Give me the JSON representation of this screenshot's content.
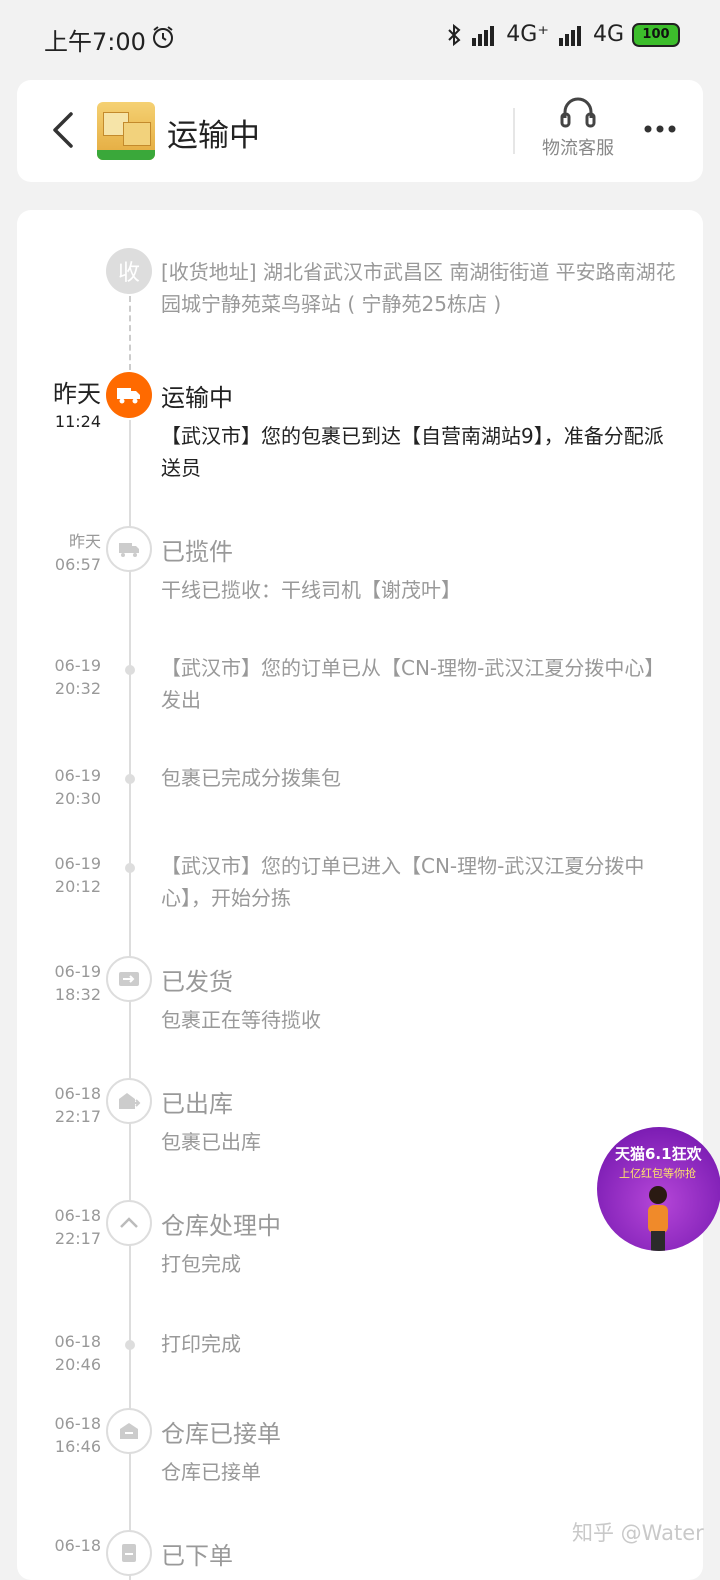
{
  "status_bar": {
    "time": "上午7:00",
    "network1": "4G⁺",
    "network2": "4G",
    "battery": "100"
  },
  "header": {
    "title": "运输中",
    "service_label": "物流客服"
  },
  "address": {
    "icon_char": "收",
    "text": "[收货地址] 湖北省武汉市武昌区 南湖街街道   平安路南湖花园城宁静苑菜鸟驿站 ( 宁静苑25栋店 )"
  },
  "events": [
    {
      "date": "昨天",
      "time": "11:24",
      "title": "运输中",
      "desc": "【武汉市】您的包裹已到达【自营南湖站9】，准备分配派送员",
      "icon": "truck-icon"
    },
    {
      "date": "昨天",
      "time": "06:57",
      "title": "已揽件",
      "desc": "干线已揽收：干线司机【谢茂叶】",
      "icon": "delivery-van-icon"
    },
    {
      "date": "06-19",
      "time": "20:32",
      "title": "",
      "desc": "【武汉市】您的订单已从【CN-理物-武汉江夏分拨中心】发出"
    },
    {
      "date": "06-19",
      "time": "20:30",
      "title": "",
      "desc": "包裹已完成分拨集包"
    },
    {
      "date": "06-19",
      "time": "20:12",
      "title": "",
      "desc": "【武汉市】您的订单已进入【CN-理物-武汉江夏分拨中心】，开始分拣"
    },
    {
      "date": "06-19",
      "time": "18:32",
      "title": "已发货",
      "desc": "包裹正在等待揽收",
      "icon": "shipped-icon"
    },
    {
      "date": "06-18",
      "time": "22:17",
      "title": "已出库",
      "desc": "包裹已出库",
      "icon": "warehouse-out-icon"
    },
    {
      "date": "06-18",
      "time": "22:17",
      "title": "仓库处理中",
      "desc": "打包完成",
      "icon": "chevron-up-icon"
    },
    {
      "date": "06-18",
      "time": "20:46",
      "title": "",
      "desc": "打印完成"
    },
    {
      "date": "06-18",
      "time": "16:46",
      "title": "仓库已接单",
      "desc": "仓库已接单",
      "icon": "warehouse-icon"
    },
    {
      "date": "06-18",
      "time": "",
      "title": "已下单",
      "desc": "",
      "icon": "order-icon"
    }
  ],
  "float_ad": {
    "line1": "天猫6.1狂欢",
    "line2": "上亿红包等你抢"
  },
  "watermark": "知乎 @Water"
}
